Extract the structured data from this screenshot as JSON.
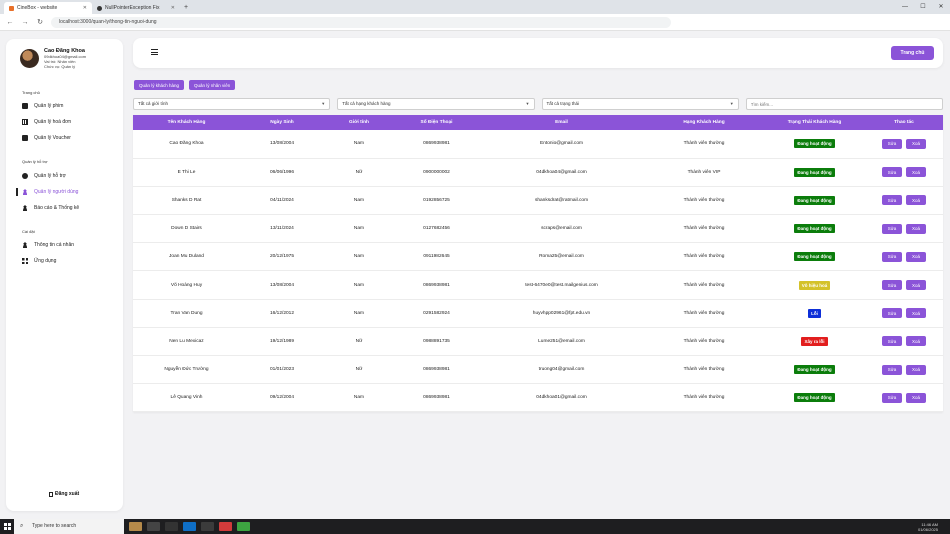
{
  "browser": {
    "tabs": [
      {
        "title": "CineBox - website",
        "active": true
      },
      {
        "title": "NullPointerException Fix",
        "active": false
      }
    ],
    "url": "localhost:3000/quan-ly/thong-tin-nguoi-dung"
  },
  "sidebar": {
    "profile": {
      "name": "Cao Đăng Khoa",
      "email": "09dkhoa04@gmail.com",
      "role": "Vai trò: Nhân viên",
      "position": "Chức vụ: Quản lý"
    },
    "sections": [
      {
        "label": "Trang chủ",
        "items": [
          {
            "label": "Quản lý phim",
            "icon": "film-icon"
          },
          {
            "label": "Quản lý hoá đơn",
            "icon": "invoice-icon"
          },
          {
            "label": "Quản lý Voucher",
            "icon": "ticket-icon"
          }
        ]
      },
      {
        "label": "Quản lý hỗ trợ",
        "items": [
          {
            "label": "Quản lý hỗ trợ",
            "icon": "chat-icon"
          },
          {
            "label": "Quản lý người dùng",
            "icon": "user-icon",
            "active": true
          },
          {
            "label": "Báo cáo & Thống kê",
            "icon": "user-icon"
          }
        ]
      },
      {
        "label": "Cài đặt",
        "items": [
          {
            "label": "Thông tin cá nhân",
            "icon": "user-icon"
          },
          {
            "label": "Ứng dụng",
            "icon": "apps-icon"
          }
        ]
      }
    ],
    "logout": "Đăng xuất"
  },
  "topbar": {
    "home_label": "Trang chủ"
  },
  "actions": {
    "customers": "Quản lý khách hàng",
    "staff": "Quản lý nhân viên"
  },
  "filters": {
    "gender": "Tất cả giới tính",
    "rank": "Tất cả hạng khách hàng",
    "status": "Tất cả trạng thái",
    "search_placeholder": "Tìm kiếm..."
  },
  "table": {
    "headers": [
      "Tên Khách Hàng",
      "Ngày Sinh",
      "Giới tính",
      "Số Điện Thoại",
      "Email",
      "Hạng Khách Hàng",
      "Trạng Thái Khách Hàng",
      "Thao tác"
    ],
    "edit_label": "Sửa",
    "delete_label": "Xoá",
    "rows": [
      {
        "name": "Cao Đăng Khoa",
        "dob": "13/08/2004",
        "gender": "Nam",
        "phone": "0869938981",
        "email": "Entonio@gmail.com",
        "rank": "Thành viên thường",
        "status": "Đang hoạt động",
        "status_color": "#0b7d0b"
      },
      {
        "name": "E Thi Le",
        "dob": "06/06/1996",
        "gender": "Nữ",
        "phone": "0900000002",
        "email": "04dkhoa04@gmail.com",
        "rank": "Thành viên VIP",
        "status": "Đang hoạt động",
        "status_color": "#0b7d0b"
      },
      {
        "name": "Shanks D Rat",
        "dob": "04/11/2024",
        "gender": "Nam",
        "phone": "0192856725",
        "email": "shanksdrat@ratmail.com",
        "rank": "Thành viên thường",
        "status": "Đang hoạt động",
        "status_color": "#0b7d0b"
      },
      {
        "name": "Down D Stairs",
        "dob": "13/11/2024",
        "gender": "Nam",
        "phone": "0127682456",
        "email": "scraps@email.com",
        "rank": "Thành viên thường",
        "status": "Đang hoạt động",
        "status_color": "#0b7d0b"
      },
      {
        "name": "Joan Mu Duland",
        "dob": "20/12/1975",
        "gender": "Nam",
        "phone": "0911982645",
        "email": "Roma25@email.com",
        "rank": "Thành viên thường",
        "status": "Đang hoạt động",
        "status_color": "#0b7d0b"
      },
      {
        "name": "Võ Hoàng Huy",
        "dob": "13/08/2004",
        "gender": "Nam",
        "phone": "0869938981",
        "email": "test-6470e0@test.mailgenius.com",
        "rank": "Thành viên thường",
        "status": "Vô hiệu hoá",
        "status_color": "#d4c22a"
      },
      {
        "name": "Tran Van Dung",
        "dob": "16/12/2012",
        "gender": "Nam",
        "phone": "0291582924",
        "email": "huyvhpp02961@fpt.edu.vn",
        "rank": "Thành viên thường",
        "status": "Lỗi",
        "status_color": "#0d2fd8"
      },
      {
        "name": "Nen Lu Mexicaz",
        "dob": "19/12/1989",
        "gender": "Nữ",
        "phone": "0988891735",
        "email": "Lume251@email.com",
        "rank": "Thành viên thường",
        "status": "Xây ra lỗi",
        "status_color": "#e21e1e"
      },
      {
        "name": "Nguyễn Đức Trường",
        "dob": "01/01/2023",
        "gender": "Nữ",
        "phone": "0869938981",
        "email": "truong04@gmail.com",
        "rank": "Thành viên thường",
        "status": "Đang hoạt động",
        "status_color": "#0b7d0b"
      },
      {
        "name": "Lê Quang Vinh",
        "dob": "09/12/2004",
        "gender": "Nam",
        "phone": "0869938981",
        "email": "04dkhoa01@gmail.com",
        "rank": "Thành viên thường",
        "status": "Đang hoạt động",
        "status_color": "#0b7d0b"
      }
    ]
  },
  "taskbar": {
    "search_placeholder": "Type here to search",
    "time": "11:46 AM",
    "date": "01/06/2025"
  }
}
